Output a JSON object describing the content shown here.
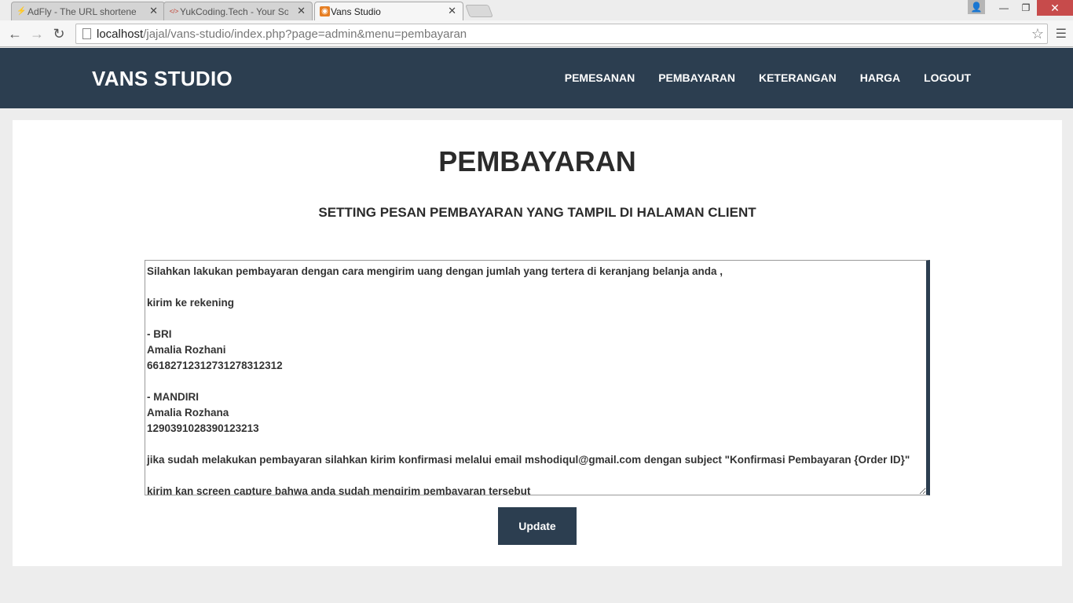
{
  "browser": {
    "tabs": [
      {
        "title": "AdFly - The URL shortener",
        "favicon": "⚡",
        "active": false
      },
      {
        "title": "YukCoding.Tech - Your So",
        "favicon": "</>",
        "active": false
      },
      {
        "title": "Vans Studio",
        "favicon": "◉",
        "active": true
      }
    ],
    "url_host": "localhost",
    "url_path": "/jajal/vans-studio/index.php?page=admin&menu=pembayaran"
  },
  "site": {
    "brand": "VANS STUDIO",
    "nav": [
      "PEMESANAN",
      "PEMBAYARAN",
      "KETERANGAN",
      "HARGA",
      "LOGOUT"
    ],
    "accent_color": "#2c3e50"
  },
  "main": {
    "title": "PEMBAYARAN",
    "subtitle": "SETTING PESAN PEMBAYARAN YANG TAMPIL DI HALAMAN CLIENT",
    "message": "Silahkan lakukan pembayaran dengan cara mengirim uang dengan jumlah yang tertera di keranjang belanja anda ,\n\nkirim ke rekening\n\n- BRI\nAmalia Rozhani\n66182712312731278312312\n\n- MANDIRI\nAmalia Rozhana\n1290391028390123213\n\njika sudah melakukan pembayaran silahkan kirim konfirmasi melalui email mshodiqul@gmail.com dengan subject \"Konfirmasi Pembayaran {Order ID}\"\n\nkirim kan screen capture bahwa anda sudah mengirim pembayaran tersebut",
    "update_label": "Update"
  }
}
